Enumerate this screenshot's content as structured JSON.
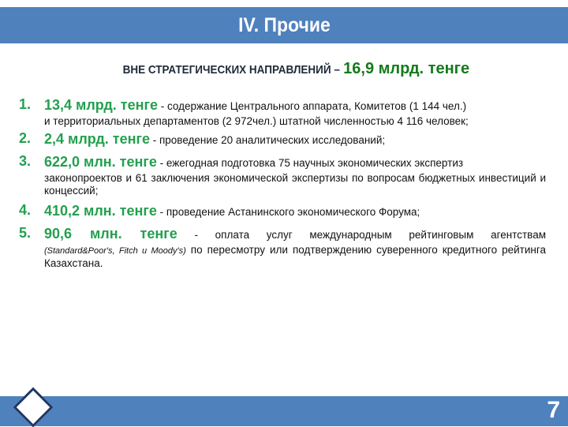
{
  "header": {
    "title": "IV. Прочие"
  },
  "subtitle": {
    "lead": "ВНЕ СТРАТЕГИЧЕСКИХ НАПРАВЛЕНИЙ –",
    "amount": "16,9 млрд. тенге"
  },
  "items": [
    {
      "number": "1.",
      "amount": "13,4 млрд. тенге",
      "text_first": " - содержание Центрального аппарата, Комитетов (1 144 чел.)",
      "text_rest": "и территориальных департаментов (2 972чел.) штатной численностью 4 116 человек;"
    },
    {
      "number": "2.",
      "amount": "2,4 млрд. тенге",
      "text_first": " - проведение 20 аналитических исследований;",
      "text_rest": ""
    },
    {
      "number": "3.",
      "amount": "622,0 млн. тенге",
      "text_first": " - ежегодная подготовка 75 научных экономических экспертиз",
      "text_rest": "законопроектов и 61 заключения экономической экспертизы по вопросам бюджетных инвестиций и концессий;"
    },
    {
      "number": "4.",
      "amount": "410,2 млн. тенге",
      "text_first": " - проведение Астанинского экономического Форума;",
      "text_rest": ""
    },
    {
      "number": "5.",
      "amount": "90,6 млн. тенге",
      "text_first": " - оплата услуг международным рейтинговым агентствам",
      "text_italic": "(Standard&Poor's, Fitch и Moody's)",
      "text_rest": " по пересмотру или подтверждению суверенного кредитного рейтинга Казахстана."
    }
  ],
  "footer": {
    "page_number": "7",
    "diamond_icon": "diamond-icon"
  },
  "colors": {
    "bar": "#4f81bd",
    "amount_green": "#23a04f",
    "subtitle_green": "#157a1c",
    "diamond_border": "#1f3864"
  }
}
